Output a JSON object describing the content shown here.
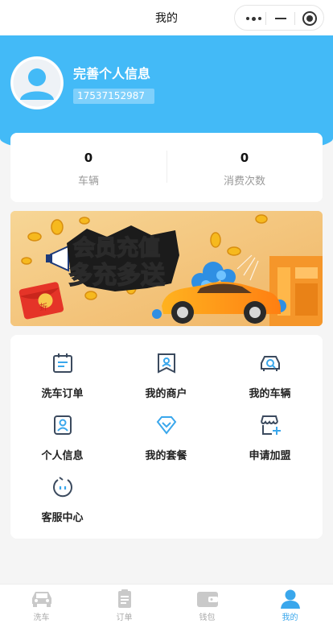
{
  "navbar": {
    "title": "我的"
  },
  "profile": {
    "title": "完善个人信息",
    "phone": "17537152987"
  },
  "stats": [
    {
      "value": "0",
      "label": "车辆"
    },
    {
      "value": "0",
      "label": "消费次数"
    }
  ],
  "banner": {
    "line1": "会员充值",
    "line2": "多充多送",
    "envelope_char": "折"
  },
  "menu": {
    "items": [
      {
        "label": "洗车订单",
        "icon": "calendar-list-icon"
      },
      {
        "label": "我的商户",
        "icon": "merchant-tag-icon"
      },
      {
        "label": "我的车辆",
        "icon": "car-search-icon"
      },
      {
        "label": "个人信息",
        "icon": "person-card-icon"
      },
      {
        "label": "我的套餐",
        "icon": "diamond-icon"
      },
      {
        "label": "申请加盟",
        "icon": "shop-plus-icon"
      },
      {
        "label": "客服中心",
        "icon": "service-face-icon"
      }
    ]
  },
  "tabbar": {
    "items": [
      {
        "label": "洗车",
        "icon": "car-icon"
      },
      {
        "label": "订单",
        "icon": "order-icon"
      },
      {
        "label": "钱包",
        "icon": "wallet-icon"
      },
      {
        "label": "我的",
        "icon": "user-icon"
      }
    ],
    "active_index": 3
  },
  "colors": {
    "primary": "#43baf7",
    "accent_icon": "#3aa7ec",
    "menu_icon": "#3b4a5e",
    "background": "#f5f5f5"
  }
}
